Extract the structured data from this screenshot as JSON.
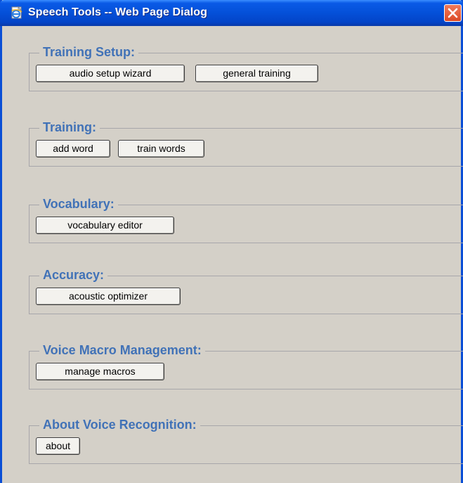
{
  "window": {
    "title": "Speech Tools -- Web Page Dialog",
    "icon": "ie-page-icon",
    "close_icon": "close-icon"
  },
  "colors": {
    "title_bar": "#0450d8",
    "legend_text": "#4172b7",
    "dialog_background": "#d4d0c8",
    "close_button": "#dc4a24"
  },
  "groups": [
    {
      "legend": "Training Setup:",
      "buttons": [
        "audio setup wizard",
        "general training"
      ]
    },
    {
      "legend": "Training:",
      "buttons": [
        "add word",
        "train words"
      ]
    },
    {
      "legend": "Vocabulary:",
      "buttons": [
        "vocabulary editor"
      ]
    },
    {
      "legend": "Accuracy:",
      "buttons": [
        "acoustic optimizer"
      ]
    },
    {
      "legend": "Voice Macro Management:",
      "buttons": [
        "manage macros"
      ]
    },
    {
      "legend": "About Voice Recognition:",
      "buttons": [
        "about"
      ]
    }
  ]
}
